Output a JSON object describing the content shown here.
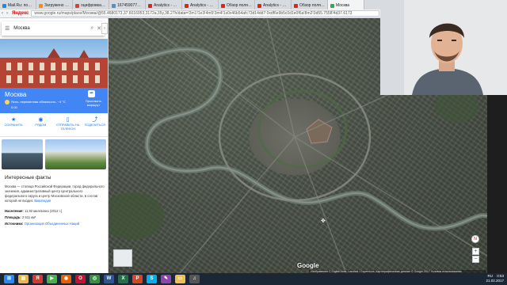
{
  "browser": {
    "tabs": [
      {
        "label": "Mail.Ru: почта, по...",
        "color": "#168de2"
      },
      {
        "label": "Загружено 1 из 1 ...",
        "color": "#ff8c00"
      },
      {
        "label": "оцифровка видео...",
        "color": "#e53935"
      },
      {
        "label": "1674590775028.jpg ...",
        "color": "#4a90d9"
      },
      {
        "label": "Analytics - YouTube",
        "color": "#e62117"
      },
      {
        "label": "Analytics - YouTube",
        "color": "#e62117"
      },
      {
        "label": "Обзор поля2мне...",
        "color": "#e62117"
      },
      {
        "label": "Analytics - YouTube",
        "color": "#e62117"
      },
      {
        "label": "Обзор поля2мне...",
        "color": "#e62117"
      },
      {
        "label": "Москва",
        "color": "#34a853"
      }
    ],
    "brand": "Яндекс",
    "url": "www.google.ru/maps/place/Москва/@55.4680173,37.6016953,3172a,35y,38.27h/data=!3m1!1e3!4m5!3m4!1s0x46b54afc73d14dd7:0xdf6e9b5c0d1e0f6a!8m2!3d55.7558!4d37.6173"
  },
  "panel": {
    "search_value": "Москва",
    "place_title": "Москва",
    "weather": "Ясно, переменная облачность, −4 °C",
    "time": "0:00",
    "directions_label": "Проложить маршрут",
    "actions": [
      {
        "icon": "star-icon",
        "glyph": "★",
        "label": "СОХРАНИТЬ"
      },
      {
        "icon": "nearby-icon",
        "glyph": "◉",
        "label": "РЯДОМ"
      },
      {
        "icon": "phone-icon",
        "glyph": "▯",
        "label": "ОТПРАВИТЬ НА ТЕЛЕФОН"
      },
      {
        "icon": "share-icon",
        "glyph": "⤴",
        "label": "ПОДЕЛИТЬСЯ"
      }
    ],
    "facts_title": "Интересные факты",
    "facts_text": "Москва — столица Российской Федерации, город федерального значения, административный центр Центрального федерального округа и центр Московской области, в состав которой не входит.",
    "facts_link": "Википедия",
    "population_label": "Население:",
    "population_value": "11,92 миллиона (2012 г.)",
    "area_label": "Площадь:",
    "area_value": "2 511 км²",
    "sources_label": "Источники:",
    "sources_value": "Организация Объединенных Наций"
  },
  "map": {
    "google_logo": "Google",
    "attribution": "Изображения © DigitalGlobe, Landsat / Copernicus, Картографические данные © Google 2017  Условия использования",
    "compass_label": "N"
  },
  "taskbar": {
    "time": "0:53",
    "date": "21.02.2017",
    "lang": "RU"
  }
}
